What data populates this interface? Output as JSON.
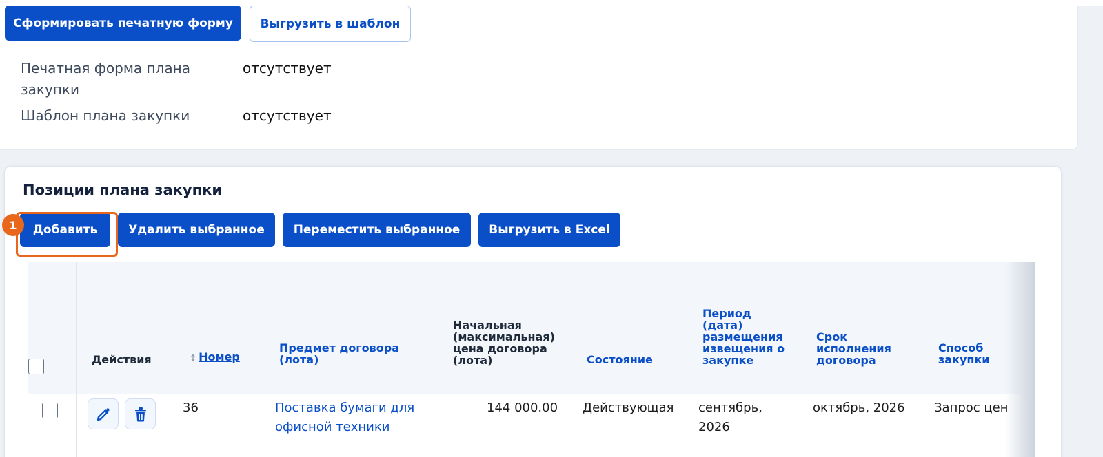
{
  "top": {
    "print_form_button": "Сформировать печатную форму",
    "export_template_button": "Выгрузить в шаблон",
    "info": [
      {
        "label": "Печатная форма плана закупки",
        "value": "отсутствует"
      },
      {
        "label": "Шаблон плана закупки",
        "value": "отсутствует"
      }
    ]
  },
  "positions": {
    "title": "Позиции плана закупки",
    "annotation_number": "1",
    "buttons": {
      "add": "Добавить",
      "delete_selected": "Удалить выбранное",
      "move_selected": "Переместить выбранное",
      "export_excel": "Выгрузить в Excel"
    },
    "columns": {
      "actions": "Действия",
      "number": "Номер",
      "subject": "Предмет договора (лота)",
      "price": "Начальная (максимальная) цена договора (лота)",
      "status": "Состояние",
      "period": "Период (дата) размещения извещения о закупке",
      "term": "Срок исполнения договора",
      "method": "Способ закупки"
    },
    "rows": [
      {
        "number": "36",
        "subject": "Поставка бумаги для офисной техники",
        "price": "144 000.00",
        "status": "Действующая",
        "period": "сентябрь, 2026",
        "term": "октябрь, 2026",
        "method": "Запрос цен"
      }
    ]
  },
  "colors": {
    "primary": "#0a4fc8",
    "highlight": "#e8671b",
    "background": "#eef1f5"
  },
  "icons": {
    "edit": "pencil-icon",
    "delete": "trash-icon",
    "sort": "sort-arrows-icon"
  }
}
